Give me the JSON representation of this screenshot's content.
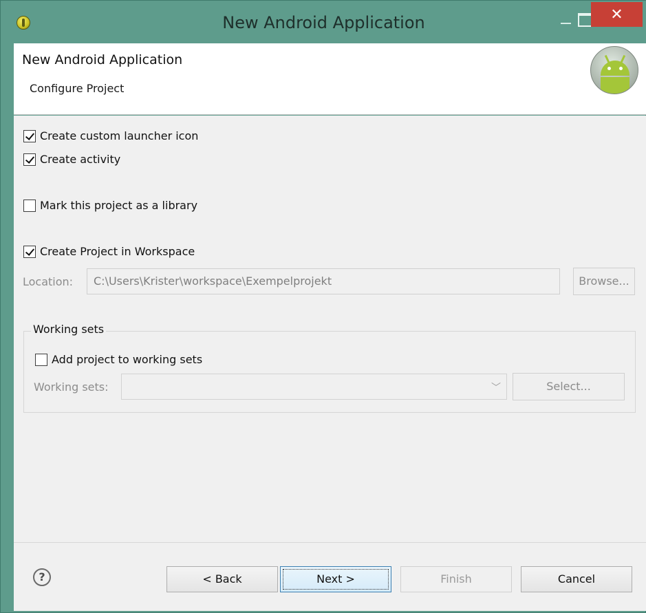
{
  "window": {
    "title": "New Android Application"
  },
  "header": {
    "title": "New Android Application",
    "subtitle": "Configure Project"
  },
  "options": {
    "create_launcher_icon": {
      "label": "Create custom launcher icon",
      "checked": true
    },
    "create_activity": {
      "label": "Create activity",
      "checked": true
    },
    "mark_library": {
      "label": "Mark this project as a library",
      "checked": false
    },
    "create_in_workspace": {
      "label": "Create Project in Workspace",
      "checked": true
    }
  },
  "location": {
    "label": "Location:",
    "value": "C:\\Users\\Krister\\workspace\\Exempelprojekt",
    "browse_label": "Browse..."
  },
  "working_sets": {
    "group_title": "Working sets",
    "add_label": "Add project to working sets",
    "add_checked": false,
    "field_label": "Working sets:",
    "value": "",
    "select_label": "Select..."
  },
  "footer": {
    "help_glyph": "?",
    "back_label": "< Back",
    "next_label": "Next >",
    "finish_label": "Finish",
    "cancel_label": "Cancel"
  },
  "colors": {
    "titlebar": "#5e9c8c",
    "close_button": "#c74036",
    "default_button_border": "#3c7fb1"
  }
}
